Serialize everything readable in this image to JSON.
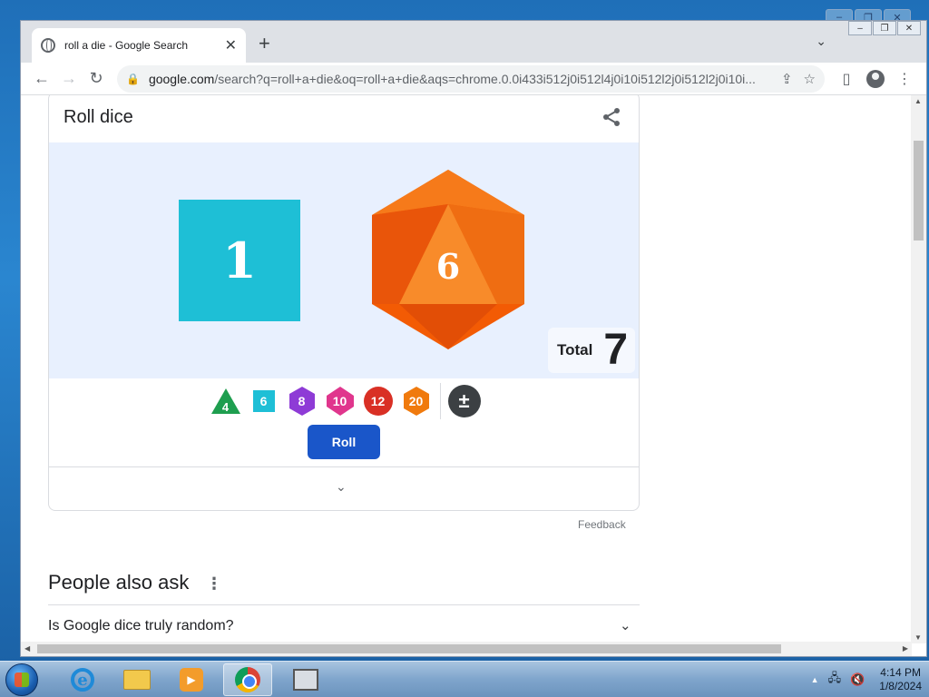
{
  "browser": {
    "tab_title": "roll a die - Google Search",
    "tab_close": "✕",
    "new_tab": "+",
    "url_domain": "google.com",
    "url_rest": "/search?q=roll+a+die&oq=roll+a+die&aqs=chrome.0.0i433i512j0i512l4j0i10i512l2j0i512l2j0i10i...",
    "icons": [
      "back-icon",
      "forward-icon",
      "reload-icon",
      "lock-icon",
      "share-icon",
      "star-icon",
      "side-panel-icon",
      "profile-icon",
      "menu-icon"
    ]
  },
  "dice_card": {
    "title": "Roll dice",
    "dice": [
      {
        "type": "d6",
        "value": "1",
        "color": "#1ebfd6"
      },
      {
        "type": "d20",
        "value": "6",
        "color": "#f35b04"
      }
    ],
    "total_label": "Total",
    "total_value": "7",
    "picker": [
      {
        "label": "4",
        "shape": "triangle",
        "color": "#1e9e4f"
      },
      {
        "label": "6",
        "shape": "square",
        "color": "#1ebfd6"
      },
      {
        "label": "8",
        "shape": "hexagon",
        "color": "#8e3bd6"
      },
      {
        "label": "10",
        "shape": "hexagon",
        "color": "#e0368d"
      },
      {
        "label": "12",
        "shape": "circle",
        "color": "#d93025"
      },
      {
        "label": "20",
        "shape": "hexagon",
        "color": "#f07a0d"
      }
    ],
    "modifier_label": "±",
    "roll_label": "Roll",
    "expand_icon": "⌄"
  },
  "feedback_label": "Feedback",
  "people_also_ask": {
    "title": "People also ask",
    "more_icon": "⋮",
    "questions": [
      "Is Google dice truly random?"
    ]
  },
  "taskbar": {
    "time": "4:14 PM",
    "date": "1/8/2024",
    "apps": [
      "internet-explorer",
      "file-explorer",
      "media-player",
      "chrome",
      "app"
    ]
  }
}
